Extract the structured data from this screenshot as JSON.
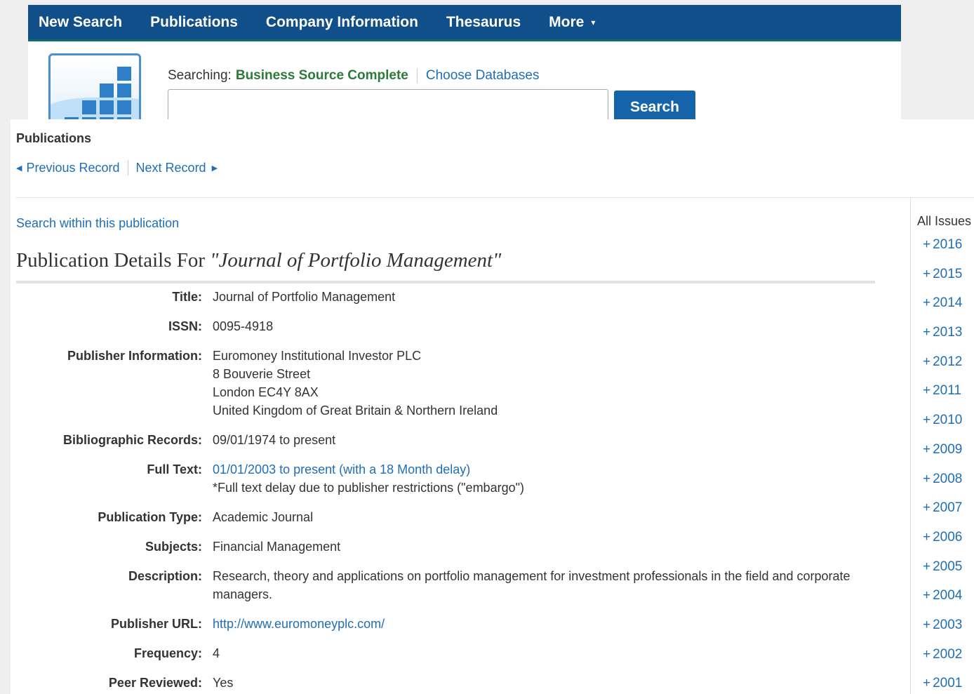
{
  "topnav": {
    "items": [
      "New Search",
      "Publications",
      "Company Information",
      "Thesaurus"
    ],
    "more": "More",
    "more_caret": "▾"
  },
  "search": {
    "searching_label": "Searching:",
    "database": "Business Source Complete",
    "choose_databases": "Choose Databases",
    "input_value": "",
    "button": "Search"
  },
  "breadcrumb": "Publications",
  "record_nav": {
    "previous": "Previous Record",
    "next": "Next Record"
  },
  "search_within": "Search within this publication",
  "heading": {
    "prefix": "Publication Details For ",
    "title": "\"Journal of Portfolio Management\""
  },
  "details": {
    "title": {
      "label": "Title:",
      "value": "Journal of Portfolio Management"
    },
    "issn": {
      "label": "ISSN:",
      "value": "0095-4918"
    },
    "publisher": {
      "label": "Publisher Information:",
      "lines": [
        "Euromoney Institutional Investor PLC",
        "8 Bouverie Street",
        "London EC4Y 8AX",
        "United Kingdom of Great Britain & Northern Ireland"
      ]
    },
    "bibliographic": {
      "label": "Bibliographic Records:",
      "value": "09/01/1974 to present"
    },
    "fulltext": {
      "label": "Full Text:",
      "link": "01/01/2003 to present (with a 18 Month delay)",
      "note": "*Full text delay due to publisher restrictions (\"embargo\")"
    },
    "pubtype": {
      "label": "Publication Type:",
      "value": "Academic Journal"
    },
    "subjects": {
      "label": "Subjects:",
      "value": "Financial Management"
    },
    "description": {
      "label": "Description:",
      "value": "Research, theory and applications on portfolio management for investment professionals in the field and corporate managers."
    },
    "url": {
      "label": "Publisher URL:",
      "value": "http://www.euromoneyplc.com/"
    },
    "frequency": {
      "label": "Frequency:",
      "value": "4"
    },
    "peer": {
      "label": "Peer Reviewed:",
      "value": "Yes"
    }
  },
  "issues": {
    "title": "All Issues",
    "years": [
      "2016",
      "2015",
      "2014",
      "2013",
      "2012",
      "2011",
      "2010",
      "2009",
      "2008",
      "2007",
      "2006",
      "2005",
      "2004",
      "2003",
      "2002",
      "2001"
    ]
  },
  "colors": {
    "header_bg": "#114f8a",
    "link": "#1e6fb8",
    "database_green": "#2c7a3a",
    "search_button": "#1564aa"
  }
}
